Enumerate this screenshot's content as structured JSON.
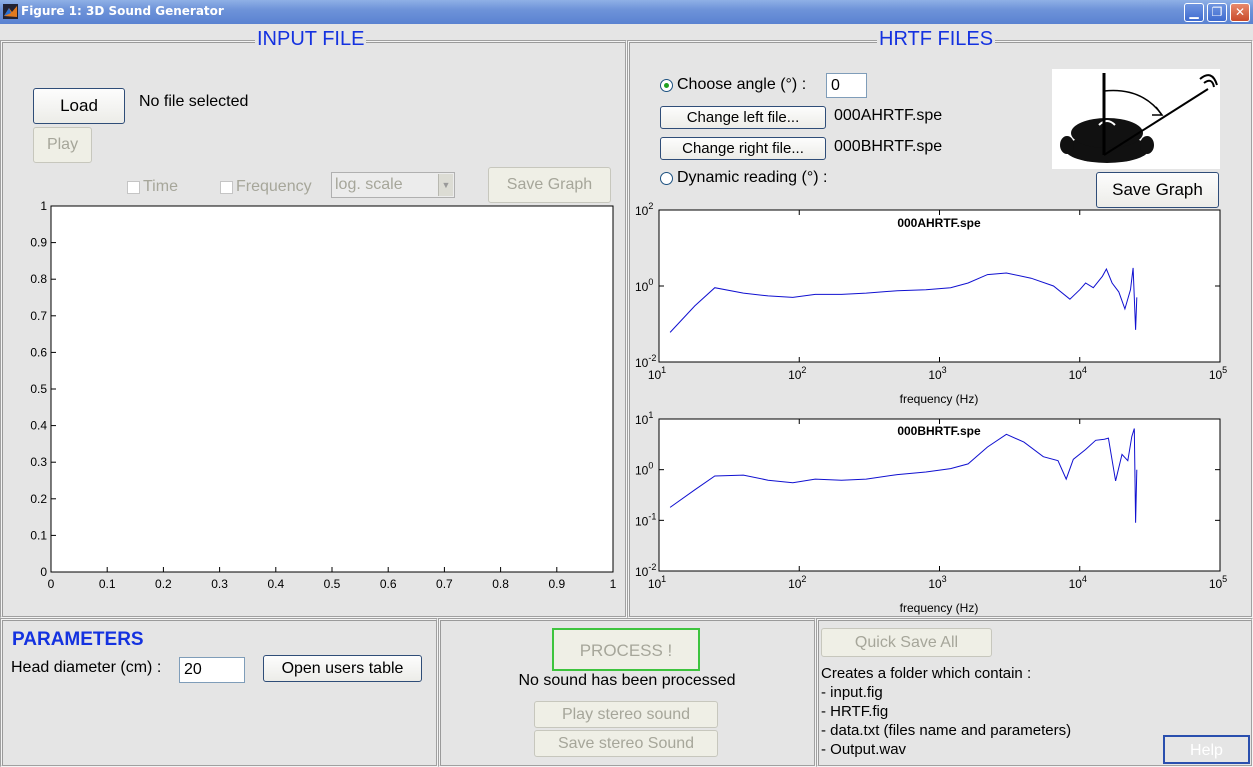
{
  "window": {
    "title": "Figure 1: 3D Sound Generator"
  },
  "input_panel": {
    "title": "INPUT FILE",
    "load_label": "Load",
    "file_status": "No file selected",
    "play_label": "Play",
    "time_label": "Time",
    "frequency_label": "Frequency",
    "scale_value": "log. scale",
    "save_graph_label": "Save Graph",
    "yticks": [
      "1",
      "0.9",
      "0.8",
      "0.7",
      "0.6",
      "0.5",
      "0.4",
      "0.3",
      "0.2",
      "0.1",
      "0"
    ],
    "xticks": [
      "0",
      "0.1",
      "0.2",
      "0.3",
      "0.4",
      "0.5",
      "0.6",
      "0.7",
      "0.8",
      "0.9",
      "1"
    ]
  },
  "hrtf_panel": {
    "title": "HRTF FILES",
    "choose_angle_label": "Choose angle (°) :",
    "angle_value": "0",
    "change_left_label": "Change left file...",
    "left_file": "000AHRTF.spe",
    "change_right_label": "Change right file...",
    "right_file": "000BHRTF.spe",
    "dynamic_label": "Dynamic reading (°) :",
    "save_graph_label": "Save Graph"
  },
  "chart_data": [
    {
      "type": "line",
      "title": "000AHRTF.spe",
      "xlabel": "frequency (Hz)",
      "xscale": "log",
      "yscale": "log",
      "xlim": [
        10,
        100000
      ],
      "ylim": [
        0.01,
        100
      ],
      "xticks": [
        {
          "base": "10",
          "exp": "1"
        },
        {
          "base": "10",
          "exp": "2"
        },
        {
          "base": "10",
          "exp": "3"
        },
        {
          "base": "10",
          "exp": "4"
        },
        {
          "base": "10",
          "exp": "5"
        }
      ],
      "yticks": [
        {
          "base": "10",
          "exp": "2"
        },
        {
          "base": "10",
          "exp": "0"
        },
        {
          "base": "10",
          "exp": "-2"
        }
      ],
      "series": [
        {
          "color": "#1010d0",
          "points": [
            [
              12,
              0.06
            ],
            [
              18,
              0.3
            ],
            [
              25,
              0.9
            ],
            [
              40,
              0.65
            ],
            [
              60,
              0.55
            ],
            [
              90,
              0.5
            ],
            [
              130,
              0.6
            ],
            [
              200,
              0.6
            ],
            [
              300,
              0.65
            ],
            [
              500,
              0.75
            ],
            [
              800,
              0.8
            ],
            [
              1200,
              0.9
            ],
            [
              1600,
              1.2
            ],
            [
              2200,
              2.0
            ],
            [
              3000,
              2.2
            ],
            [
              4500,
              1.6
            ],
            [
              6500,
              1.0
            ],
            [
              8500,
              0.45
            ],
            [
              10000,
              0.8
            ],
            [
              11000,
              1.2
            ],
            [
              12500,
              0.9
            ],
            [
              14500,
              1.8
            ],
            [
              15500,
              2.8
            ],
            [
              17000,
              1.2
            ],
            [
              19000,
              0.7
            ],
            [
              21000,
              0.25
            ],
            [
              23000,
              0.8
            ],
            [
              24000,
              3.0
            ],
            [
              25000,
              0.07
            ],
            [
              25500,
              0.5
            ]
          ]
        }
      ]
    },
    {
      "type": "line",
      "title": "000BHRTF.spe",
      "xlabel": "frequency (Hz)",
      "xscale": "log",
      "yscale": "log",
      "xlim": [
        10,
        100000
      ],
      "ylim": [
        0.01,
        10
      ],
      "xticks": [
        {
          "base": "10",
          "exp": "1"
        },
        {
          "base": "10",
          "exp": "2"
        },
        {
          "base": "10",
          "exp": "3"
        },
        {
          "base": "10",
          "exp": "4"
        },
        {
          "base": "10",
          "exp": "5"
        }
      ],
      "yticks": [
        {
          "base": "10",
          "exp": "1"
        },
        {
          "base": "10",
          "exp": "0"
        },
        {
          "base": "10",
          "exp": "-1"
        },
        {
          "base": "10",
          "exp": "-2"
        }
      ],
      "series": [
        {
          "color": "#1010d0",
          "points": [
            [
              12,
              0.18
            ],
            [
              18,
              0.4
            ],
            [
              25,
              0.75
            ],
            [
              40,
              0.78
            ],
            [
              60,
              0.62
            ],
            [
              90,
              0.55
            ],
            [
              130,
              0.65
            ],
            [
              200,
              0.62
            ],
            [
              300,
              0.65
            ],
            [
              500,
              0.8
            ],
            [
              800,
              0.9
            ],
            [
              1200,
              1.05
            ],
            [
              1600,
              1.3
            ],
            [
              2200,
              2.8
            ],
            [
              3000,
              5.0
            ],
            [
              4000,
              3.5
            ],
            [
              5500,
              1.8
            ],
            [
              7000,
              1.5
            ],
            [
              8000,
              0.65
            ],
            [
              9000,
              1.6
            ],
            [
              11000,
              2.5
            ],
            [
              13000,
              3.8
            ],
            [
              15000,
              4.0
            ],
            [
              16000,
              4.2
            ],
            [
              18000,
              0.6
            ],
            [
              20000,
              2.0
            ],
            [
              22000,
              1.5
            ],
            [
              23500,
              4.5
            ],
            [
              24500,
              6.5
            ],
            [
              25000,
              0.09
            ],
            [
              25500,
              1.0
            ]
          ]
        }
      ]
    }
  ],
  "parameters": {
    "title": "PARAMETERS",
    "head_label": "Head diameter (cm) :",
    "head_value": "20",
    "users_table_label": "Open users table"
  },
  "process": {
    "process_label": "PROCESS !",
    "status": "No sound has been processed",
    "play_stereo_label": "Play stereo sound",
    "save_stereo_label": "Save stereo Sound"
  },
  "save_panel": {
    "quick_save_label": "Quick Save All",
    "description": [
      "Creates a folder which contain :",
      "- input.fig",
      "- HRTF.fig",
      "- data.txt (files name and parameters)",
      "- Output.wav"
    ],
    "help_label": "Help"
  }
}
